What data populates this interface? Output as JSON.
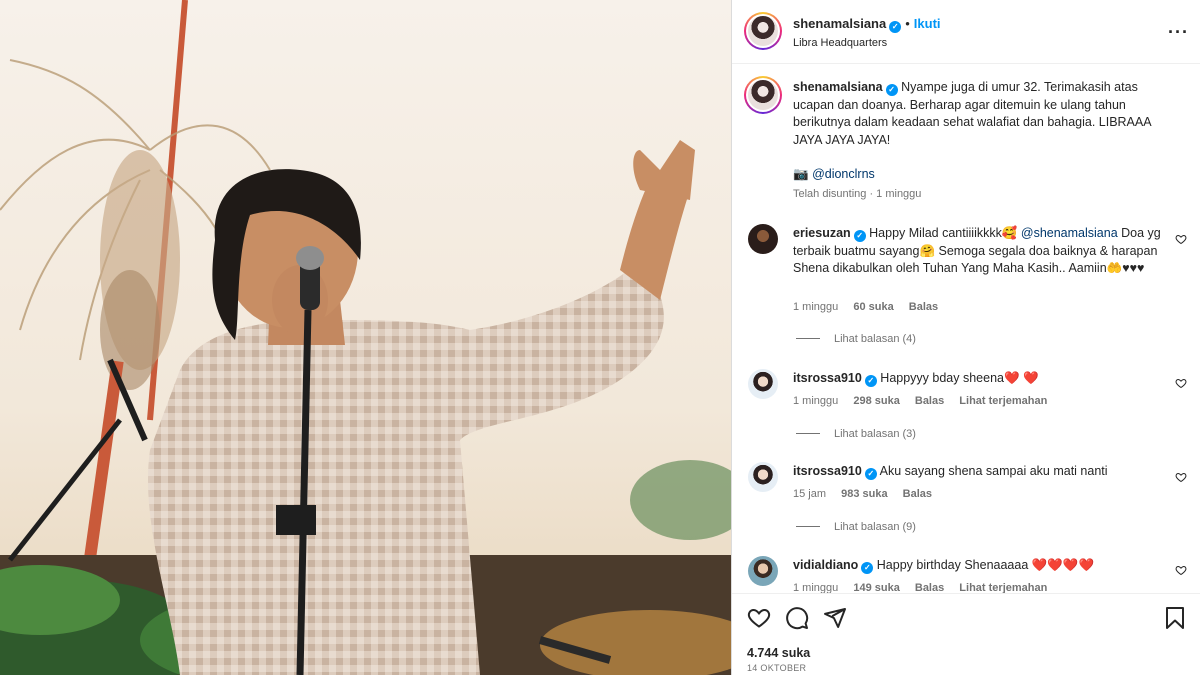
{
  "post": {
    "author": "shenamalsiana",
    "follow_label": "Ikuti",
    "dot": "•",
    "location": "Libra Headquarters",
    "more_icon": "more-options-icon",
    "caption": "Nyampe juga di umur 32. Terimakasih atas ucapan dan doanya. Berharap agar ditemuin ke ulang tahun berikutnya dalam keadaan sehat walafiat dan bahagia. LIBRAAA JAYA JAYA JAYA!",
    "photo_credit_icon": "📷",
    "photo_credit": "@dionclrns",
    "caption_meta": "Telah disunting · 1 minggu",
    "likes": "4.744 suka",
    "date": "14 OKTOBER"
  },
  "comments": [
    {
      "user": "eriesuzan",
      "text_a": "Happy Milad cantiiiikkkk🥰",
      "mention": "@shenamalsiana",
      "text_b": "Doa yg terbaik buatmu sayang🤗 Semoga segala doa baiknya & harapan Shena dikabulkan oleh Tuhan Yang Maha Kasih.. Aamiin🤲♥♥♥",
      "time": "1 minggu",
      "likes": "60 suka",
      "reply": "Balas",
      "view_replies": "Lihat balasan (4)"
    },
    {
      "user": "itsrossa910",
      "text": "Happyyy bday sheena❤️ ❤️",
      "time": "1 minggu",
      "likes": "298 suka",
      "reply": "Balas",
      "translate": "Lihat terjemahan",
      "view_replies": "Lihat balasan (3)"
    },
    {
      "user": "itsrossa910",
      "text": "Aku sayang shena sampai aku mati nanti",
      "time": "15 jam",
      "likes": "983 suka",
      "reply": "Balas",
      "view_replies": "Lihat balasan (9)"
    },
    {
      "user": "vidialdiano",
      "text": "Happy birthday Shenaaaaa ❤️❤️❤️❤️",
      "time": "1 minggu",
      "likes": "149 suka",
      "reply": "Balas",
      "translate": "Lihat terjemahan"
    }
  ],
  "icons": {
    "like": "heart-icon",
    "comment": "comment-bubble-icon",
    "share": "send-icon",
    "save": "bookmark-icon"
  },
  "colors": {
    "accent": "#0095f6",
    "text": "#262626",
    "muted": "#737373",
    "heart": "#ed1c24"
  }
}
